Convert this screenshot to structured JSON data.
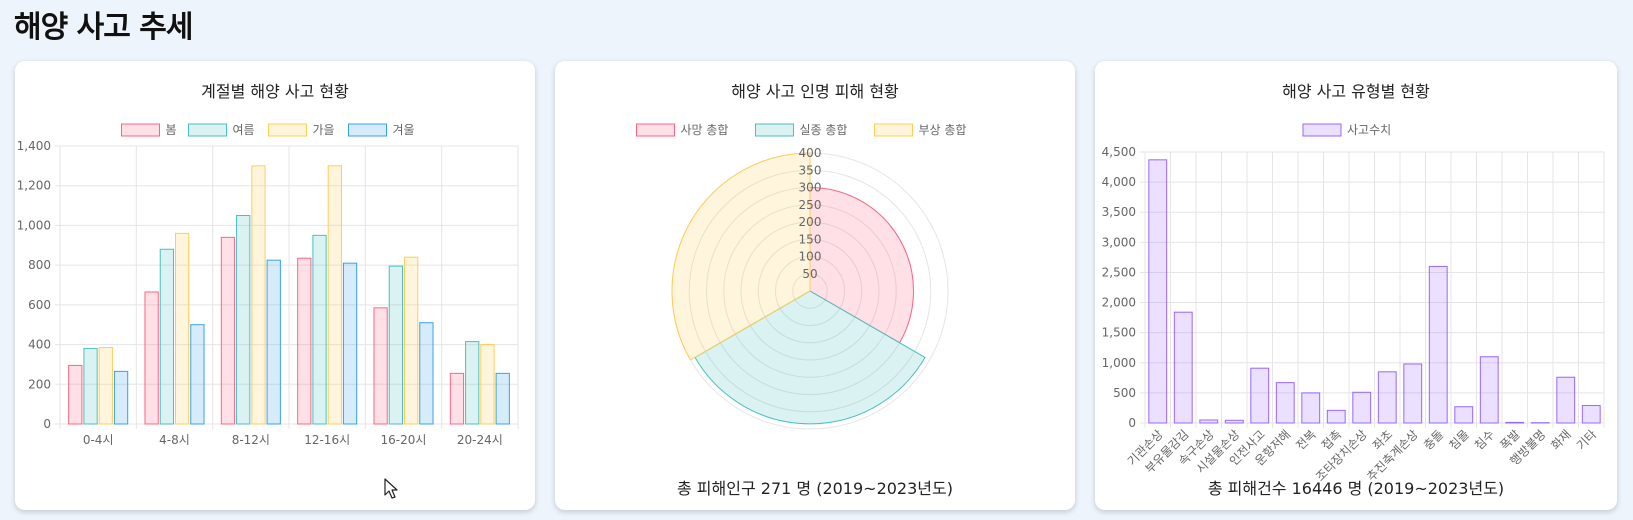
{
  "page": {
    "title": "해양 사고 추세"
  },
  "cards": [
    {
      "title": "계절별 해양 사고 현황",
      "footer": ""
    },
    {
      "title": "해양 사고 인명 피해 현황",
      "footer": "총 피해인구 271 명 (2019~2023년도)"
    },
    {
      "title": "해양 사고 유형별 현황",
      "footer": "총 피해건수 16446 명 (2019~2023년도)"
    }
  ],
  "chart_data": [
    {
      "type": "bar",
      "title": "계절별 해양 사고 현황",
      "categories": [
        "0-4시",
        "4-8시",
        "8-12시",
        "12-16시",
        "16-20시",
        "20-24시"
      ],
      "series": [
        {
          "name": "봄",
          "values": [
            295,
            665,
            940,
            835,
            585,
            255
          ],
          "color": "#ff6384"
        },
        {
          "name": "여름",
          "values": [
            380,
            880,
            1050,
            950,
            795,
            415
          ],
          "color": "#4bc0c0"
        },
        {
          "name": "가을",
          "values": [
            385,
            960,
            1300,
            1300,
            840,
            400
          ],
          "color": "#ffcd56"
        },
        {
          "name": "겨울",
          "values": [
            265,
            500,
            825,
            810,
            510,
            255
          ],
          "color": "#36a2eb"
        }
      ],
      "ylim": [
        0,
        1400
      ],
      "yticks": [
        "0",
        "200",
        "400",
        "600",
        "800",
        "1,000",
        "1,200",
        "1,400"
      ],
      "grid": true,
      "legend": "top"
    },
    {
      "type": "polarArea",
      "title": "해양 사고 인명 피해 현황",
      "categories": [
        "사망 총합",
        "실종 총합",
        "부상 총합"
      ],
      "values": [
        300,
        385,
        400
      ],
      "colors": [
        "#ff6384",
        "#4bc0c0",
        "#ffcd56"
      ],
      "rlim": [
        0,
        400
      ],
      "rticks": [
        "50",
        "100",
        "150",
        "200",
        "250",
        "300",
        "350",
        "400"
      ],
      "legend": "top"
    },
    {
      "type": "bar",
      "title": "해양 사고 유형별 현황",
      "categories": [
        "기관손상",
        "부유물감김",
        "속구손상",
        "시설물손상",
        "인전사고",
        "운항저해",
        "전복",
        "접촉",
        "조타장치손상",
        "좌초",
        "추진축계손상",
        "충돌",
        "침몰",
        "침수",
        "폭발",
        "행방불명",
        "화재",
        "기타"
      ],
      "series": [
        {
          "name": "사고수치",
          "values": [
            4370,
            1840,
            50,
            45,
            910,
            670,
            500,
            210,
            510,
            850,
            980,
            2600,
            270,
            1100,
            10,
            5,
            760,
            290
          ],
          "color": "#9966ff"
        }
      ],
      "ylim": [
        0,
        4500
      ],
      "yticks": [
        "0",
        "500",
        "1,000",
        "1,500",
        "2,000",
        "2,500",
        "3,000",
        "3,500",
        "4,000",
        "4,500"
      ],
      "grid": true,
      "legend": "top"
    }
  ]
}
